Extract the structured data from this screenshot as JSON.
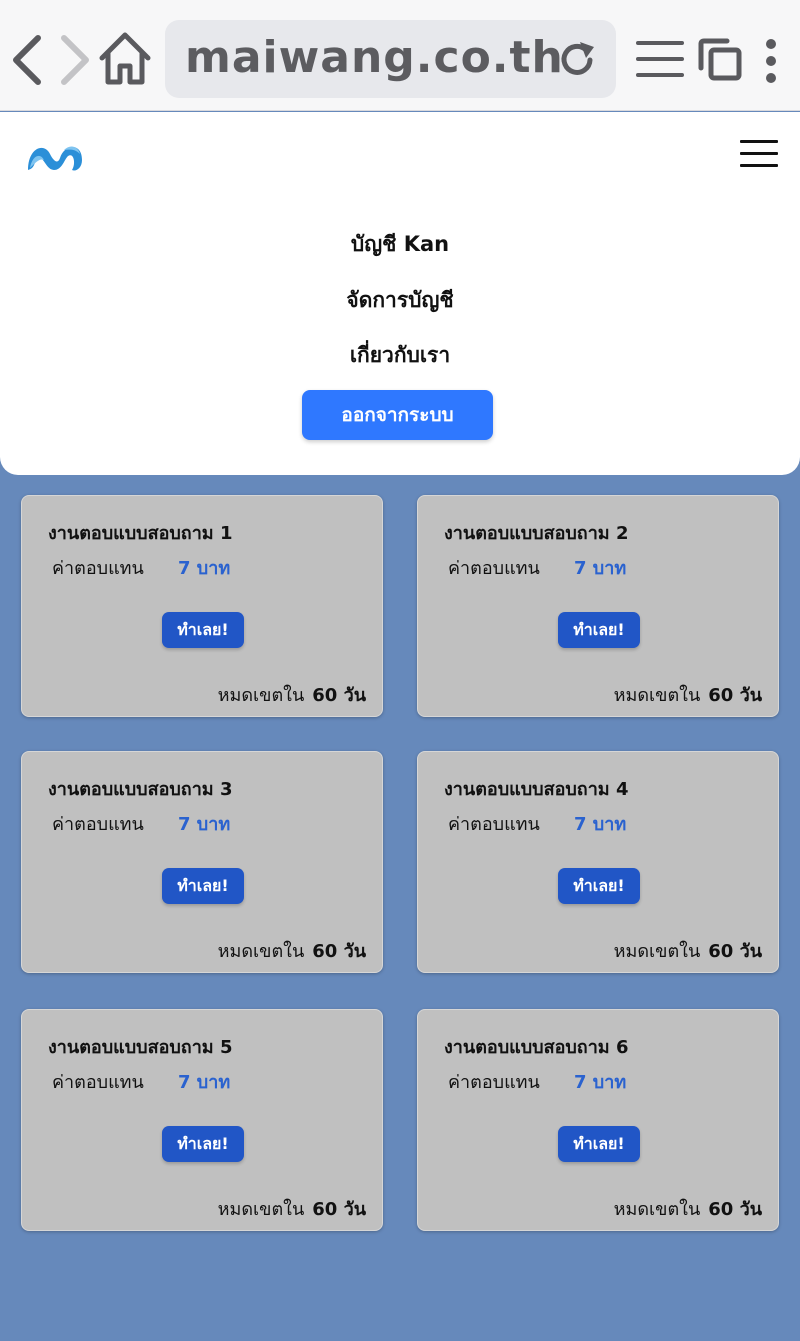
{
  "browser": {
    "url": "maiwang.co.th"
  },
  "header": {
    "menu": {
      "account": "บัญชี Kan",
      "manage_account": "จัดการบัญชี",
      "about": "เกี่ยวกับเรา"
    },
    "logout_label": "ออกจากระบบ"
  },
  "surveys": [
    {
      "title": "งานตอบแบบสอบถาม 1",
      "reward_label": "ค่าตอบแทน",
      "reward": "7 บาท",
      "button": "ทำเลย!",
      "expire_label": "หมดเขตใน",
      "expire_value": "60 วัน"
    },
    {
      "title": "งานตอบแบบสอบถาม 2",
      "reward_label": "ค่าตอบแทน",
      "reward": "7 บาท",
      "button": "ทำเลย!",
      "expire_label": "หมดเขตใน",
      "expire_value": "60 วัน"
    },
    {
      "title": "งานตอบแบบสอบถาม 3",
      "reward_label": "ค่าตอบแทน",
      "reward": "7 บาท",
      "button": "ทำเลย!",
      "expire_label": "หมดเขตใน",
      "expire_value": "60 วัน"
    },
    {
      "title": "งานตอบแบบสอบถาม 4",
      "reward_label": "ค่าตอบแทน",
      "reward": "7 บาท",
      "button": "ทำเลย!",
      "expire_label": "หมดเขตใน",
      "expire_value": "60 วัน"
    },
    {
      "title": "งานตอบแบบสอบถาม 5",
      "reward_label": "ค่าตอบแทน",
      "reward": "7 บาท",
      "button": "ทำเลย!",
      "expire_label": "หมดเขตใน",
      "expire_value": "60 วัน"
    },
    {
      "title": "งานตอบแบบสอบถาม 6",
      "reward_label": "ค่าตอบแทน",
      "reward": "7 บาท",
      "button": "ทำเลย!",
      "expire_label": "หมดเขตใน",
      "expire_value": "60 วัน"
    }
  ],
  "icons": {
    "back": "chevron-left-icon",
    "forward": "chevron-right-icon",
    "home": "home-icon",
    "reload": "reload-icon",
    "menu": "menu-icon",
    "tabs": "tabs-icon",
    "more": "more-vertical-icon",
    "hamburger": "hamburger-icon"
  },
  "colors": {
    "page_bg": "#6689bb",
    "primary_button": "#2f78ff",
    "card_button": "#2156c6",
    "reward_text": "#2a62cf",
    "card_bg": "#c0c0c0"
  }
}
